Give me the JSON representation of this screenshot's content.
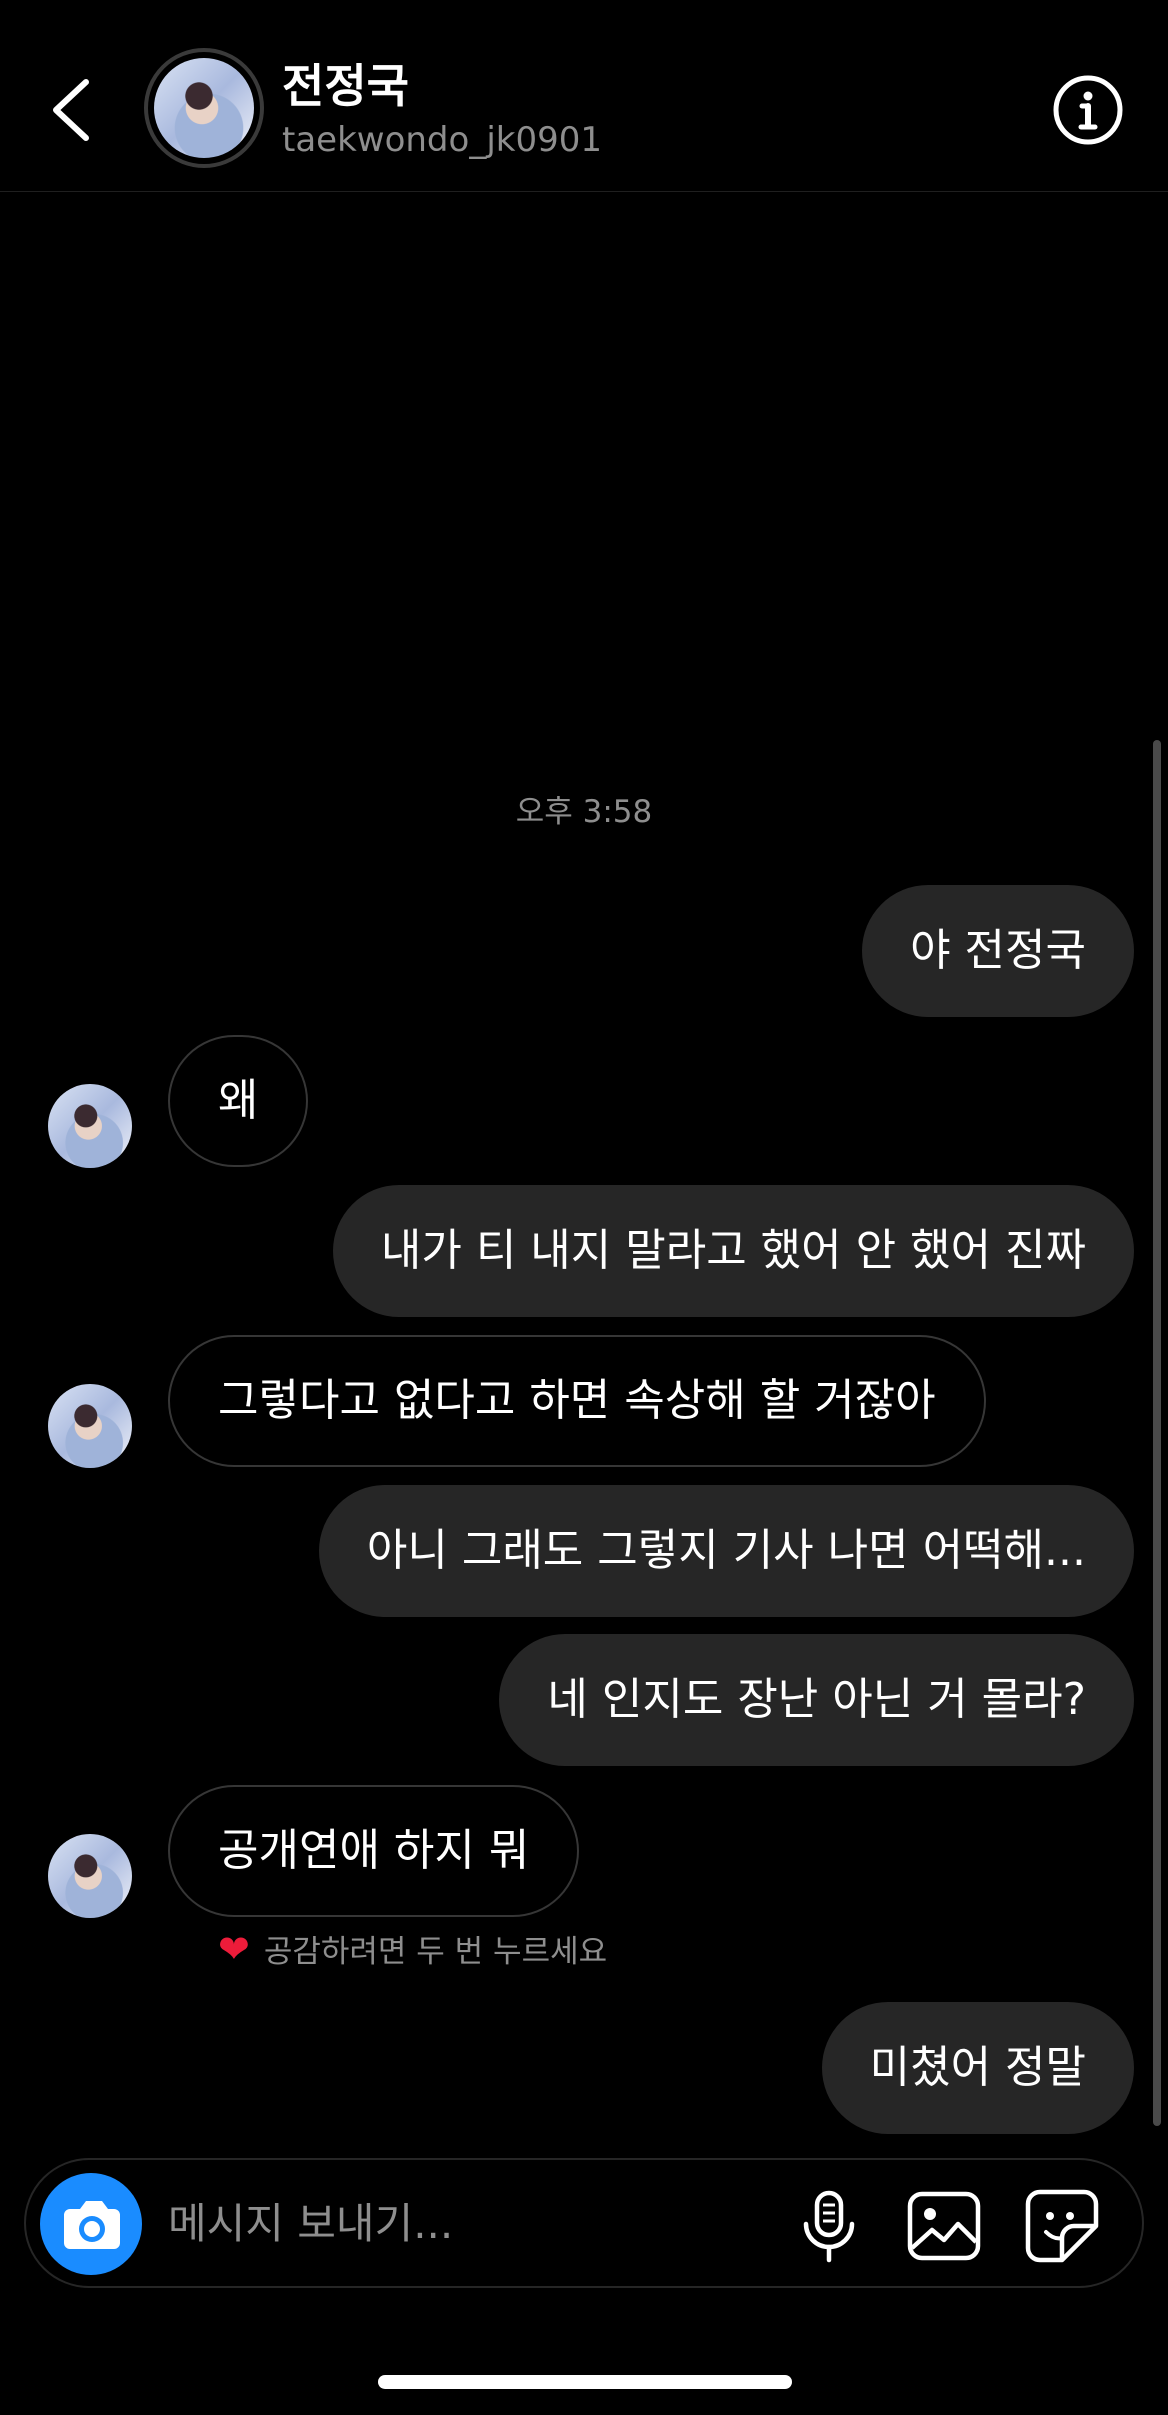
{
  "header": {
    "name": "전정국",
    "username": "taekwondo_jk0901"
  },
  "timestamp": "오후 3:58",
  "messages": [
    {
      "from": "me",
      "text": "야 전정국"
    },
    {
      "from": "them",
      "text": "왜"
    },
    {
      "from": "me",
      "text": "내가 티 내지 말라고 했어 안 했어 진짜"
    },
    {
      "from": "them",
      "text": "그렇다고 없다고 하면 속상해 할 거잖아"
    },
    {
      "from": "me",
      "text": "아니 그래도 그렇지 기사 나면 어떡해..."
    },
    {
      "from": "me",
      "text": "네 인지도 장난 아닌 거 몰라?"
    },
    {
      "from": "them",
      "text": "공개연애 하지 뭐"
    },
    {
      "from": "me",
      "text": "미쳤어 정말"
    }
  ],
  "reaction_hint": "공감하려면 두 번 누르세요",
  "composer": {
    "placeholder": "메시지 보내기..."
  },
  "icons": {
    "back": "chevron-left-icon",
    "info": "info-icon",
    "camera": "camera-icon",
    "mic": "microphone-icon",
    "gallery": "image-icon",
    "sticker": "sticker-icon",
    "heart": "heart-icon"
  },
  "colors": {
    "background": "#000000",
    "bubble_outgoing": "#262626",
    "bubble_incoming_border": "#363636",
    "secondary_text": "#8e8e8e",
    "camera_button": "#1a8cff",
    "heart": "#ed1c3a"
  }
}
